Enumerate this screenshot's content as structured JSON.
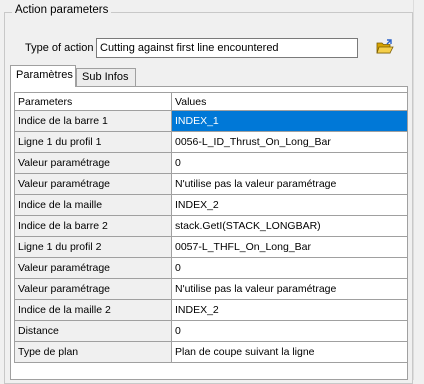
{
  "group": {
    "legend": "Action parameters"
  },
  "type_of_action": {
    "label": "Type of action",
    "value": "Cutting against first line encountered"
  },
  "icons": {
    "open_folder": "open-folder-icon"
  },
  "tabs": [
    {
      "label": "Paramètres",
      "active": true
    },
    {
      "label": "Sub Infos",
      "active": false
    }
  ],
  "grid": {
    "headers": [
      "Parameters",
      "Values"
    ],
    "selected_row": 0,
    "rows": [
      {
        "param": "Indice de la barre 1",
        "value": "INDEX_1"
      },
      {
        "param": "Ligne 1 du profil 1",
        "value": "0056-L_ID_Thrust_On_Long_Bar"
      },
      {
        "param": "Valeur paramétrage",
        "value": "0"
      },
      {
        "param": "Valeur paramétrage",
        "value": "N'utilise pas la valeur paramétrage"
      },
      {
        "param": "Indice de la maille",
        "value": "INDEX_2"
      },
      {
        "param": "Indice de la barre 2",
        "value": "stack.GetI(STACK_LONGBAR)"
      },
      {
        "param": "Ligne 1 du profil 2",
        "value": "0057-L_THFL_On_Long_Bar"
      },
      {
        "param": "Valeur paramétrage",
        "value": "0"
      },
      {
        "param": "Valeur paramétrage",
        "value": "N'utilise pas la valeur paramétrage"
      },
      {
        "param": "Indice de la maille 2",
        "value": "INDEX_2"
      },
      {
        "param": "Distance",
        "value": "0"
      },
      {
        "param": "Type de plan",
        "value": "Plan de coupe suivant la ligne"
      }
    ]
  }
}
